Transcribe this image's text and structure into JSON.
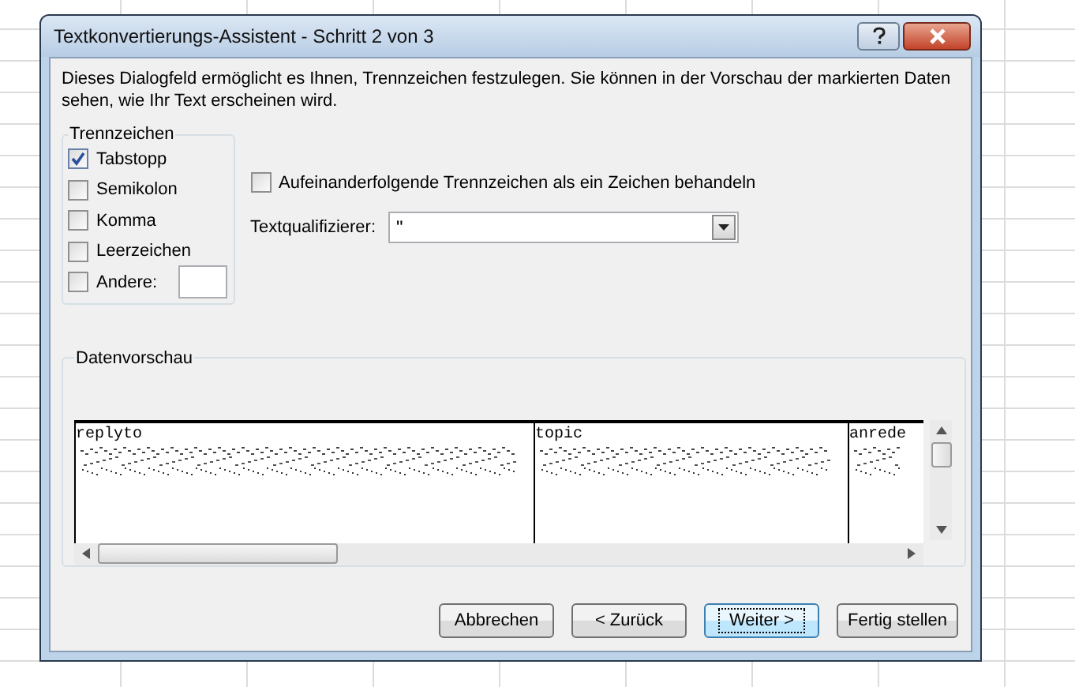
{
  "window": {
    "title": "Textkonvertierungs-Assistent - Schritt 2 von 3"
  },
  "description": "Dieses Dialogfeld ermöglicht es Ihnen, Trennzeichen festzulegen. Sie können in der Vorschau der markierten Daten sehen, wie Ihr Text erscheinen wird.",
  "delimiters": {
    "title": "Trennzeichen",
    "items": [
      {
        "label": "Tabstopp",
        "checked": true
      },
      {
        "label": "Semikolon",
        "checked": false
      },
      {
        "label": "Komma",
        "checked": false
      },
      {
        "label": "Leerzeichen",
        "checked": false
      },
      {
        "label": "Andere:",
        "checked": false,
        "kind": "other"
      }
    ]
  },
  "consecutive": {
    "label": "Aufeinanderfolgende Trennzeichen als ein Zeichen behandeln",
    "checked": false
  },
  "qualifier": {
    "label": "Textqualifizierer:",
    "value": "\""
  },
  "preview": {
    "title": "Datenvorschau",
    "columns": [
      "replyto",
      "topic",
      "anrede"
    ]
  },
  "buttons": [
    {
      "label": "Abbrechen",
      "focused": false
    },
    {
      "label": "< Zurück",
      "focused": false
    },
    {
      "label": "Weiter >",
      "focused": true
    },
    {
      "label": "Fertig stellen",
      "focused": false
    }
  ]
}
